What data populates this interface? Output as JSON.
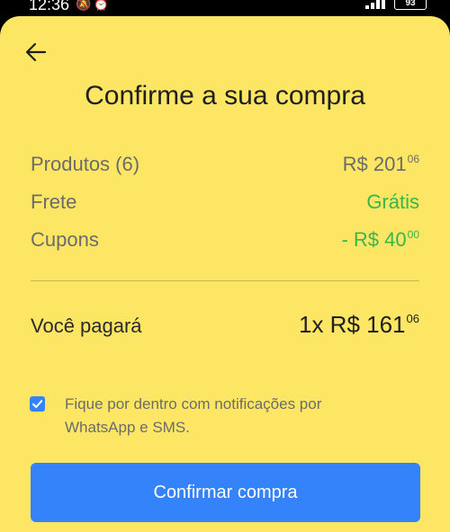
{
  "status_bar": {
    "time": "12:36",
    "battery": "93",
    "icons": [
      "muted-notifications-icon",
      "alarm-icon",
      "signal-icon",
      "battery-icon"
    ]
  },
  "header": {
    "title": "Confirme a sua compra"
  },
  "summary": {
    "products": {
      "label": "Produtos (6)",
      "currency": "R$",
      "amount": "201",
      "cents": "06"
    },
    "shipping": {
      "label": "Frete",
      "value": "Grátis"
    },
    "coupons": {
      "label": "Cupons",
      "prefix": "- R$",
      "amount": "40",
      "cents": "00"
    }
  },
  "total": {
    "label": "Você pagará",
    "installments": "1x R$",
    "amount": "161",
    "cents": "06"
  },
  "notifications": {
    "checked": true,
    "text": "Fique por dentro com notificações por WhatsApp e SMS."
  },
  "actions": {
    "confirm_label": "Confirmar compra"
  },
  "colors": {
    "sheet_background": "#fee665",
    "primary_button": "#3483fa",
    "free_shipping_green": "#39b54a"
  }
}
